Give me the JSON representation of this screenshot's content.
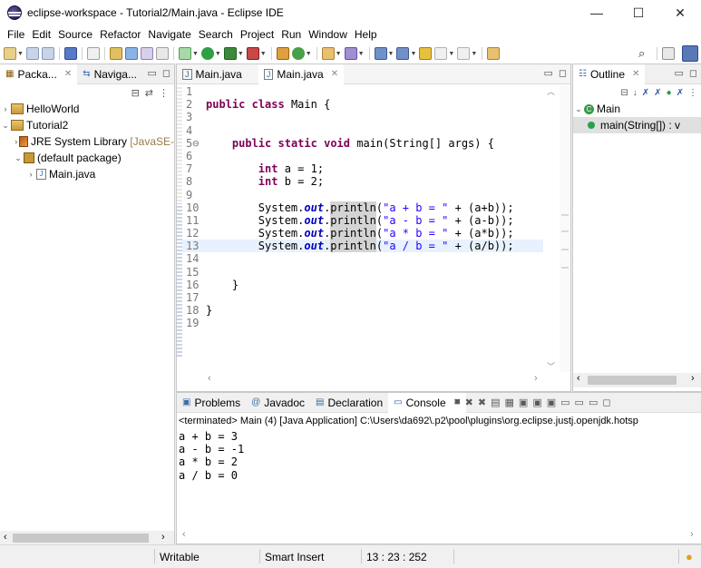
{
  "window": {
    "title": "eclipse-workspace - Tutorial2/Main.java - Eclipse IDE",
    "minimize": "—",
    "maximize": "☐",
    "close": "✕"
  },
  "menu": [
    "File",
    "Edit",
    "Source",
    "Refactor",
    "Navigate",
    "Search",
    "Project",
    "Run",
    "Window",
    "Help"
  ],
  "left_panel": {
    "tabs": [
      {
        "label": "Packa...",
        "close": "✕"
      },
      {
        "label": "Naviga...",
        "close": ""
      }
    ],
    "tree": [
      {
        "label": "HelloWorld",
        "icon": "project-icon",
        "twisty": "›",
        "indent": 0
      },
      {
        "label": "Tutorial2",
        "icon": "project-icon",
        "twisty": "⌄",
        "indent": 0
      },
      {
        "label": "JRE System Library",
        "suffix": "[JavaSE-",
        "icon": "library-icon",
        "twisty": "›",
        "indent": 1
      },
      {
        "label": "(default package)",
        "icon": "package-icon",
        "twisty": "⌄",
        "indent": 1
      },
      {
        "label": "Main.java",
        "icon": "java-file-icon",
        "twisty": "›",
        "indent": 2
      }
    ]
  },
  "editor": {
    "tabs": [
      {
        "label": "Main.java",
        "close": ""
      },
      {
        "label": "Main.java",
        "close": "✕"
      }
    ],
    "lines": [
      {
        "n": "1",
        "t": ""
      },
      {
        "n": "2",
        "t": "public class Main {"
      },
      {
        "n": "3",
        "t": ""
      },
      {
        "n": "4",
        "t": ""
      },
      {
        "n": "5⊖",
        "t": "    public static void main(String[] args) {"
      },
      {
        "n": "6",
        "t": ""
      },
      {
        "n": "7",
        "t": "        int a = 1;"
      },
      {
        "n": "8",
        "t": "        int b = 2;"
      },
      {
        "n": "9",
        "t": ""
      },
      {
        "n": "10",
        "t": "        System.out.println(\"a + b = \" + (a+b));"
      },
      {
        "n": "11",
        "t": "        System.out.println(\"a - b = \" + (a-b));"
      },
      {
        "n": "12",
        "t": "        System.out.println(\"a * b = \" + (a*b));"
      },
      {
        "n": "13",
        "t": "        System.out.println(\"a / b = \" + (a/b));"
      },
      {
        "n": "14",
        "t": ""
      },
      {
        "n": "15",
        "t": ""
      },
      {
        "n": "16",
        "t": "    }"
      },
      {
        "n": "17",
        "t": ""
      },
      {
        "n": "18",
        "t": "}"
      },
      {
        "n": "19",
        "t": ""
      }
    ]
  },
  "outline": {
    "tab": "Outline",
    "close": "✕",
    "items": [
      {
        "label": "Main",
        "twisty": "⌄"
      },
      {
        "label": "main(String[]) : v"
      }
    ]
  },
  "bottom_panel": {
    "tabs": [
      {
        "label": "Problems",
        "icon": "problems-icon"
      },
      {
        "label": "Javadoc",
        "icon": "javadoc-icon"
      },
      {
        "label": "Declaration",
        "icon": "declaration-icon"
      },
      {
        "label": "Console",
        "icon": "console-icon",
        "close": "✕"
      }
    ],
    "header": "<terminated> Main (4) [Java Application] C:\\Users\\da692\\.p2\\pool\\plugins\\org.eclipse.justj.openjdk.hotsp",
    "output": [
      "a + b = 3",
      "a - b = -1",
      "a * b = 2",
      "a / b = 0"
    ]
  },
  "status": {
    "writable": "Writable",
    "insert_mode": "Smart Insert",
    "position": "13 : 23 : 252"
  },
  "colors": {
    "keyword": "#7f0055",
    "string": "#2a00ff",
    "field": "#0000c0",
    "current_line": "#e8f2fe"
  }
}
